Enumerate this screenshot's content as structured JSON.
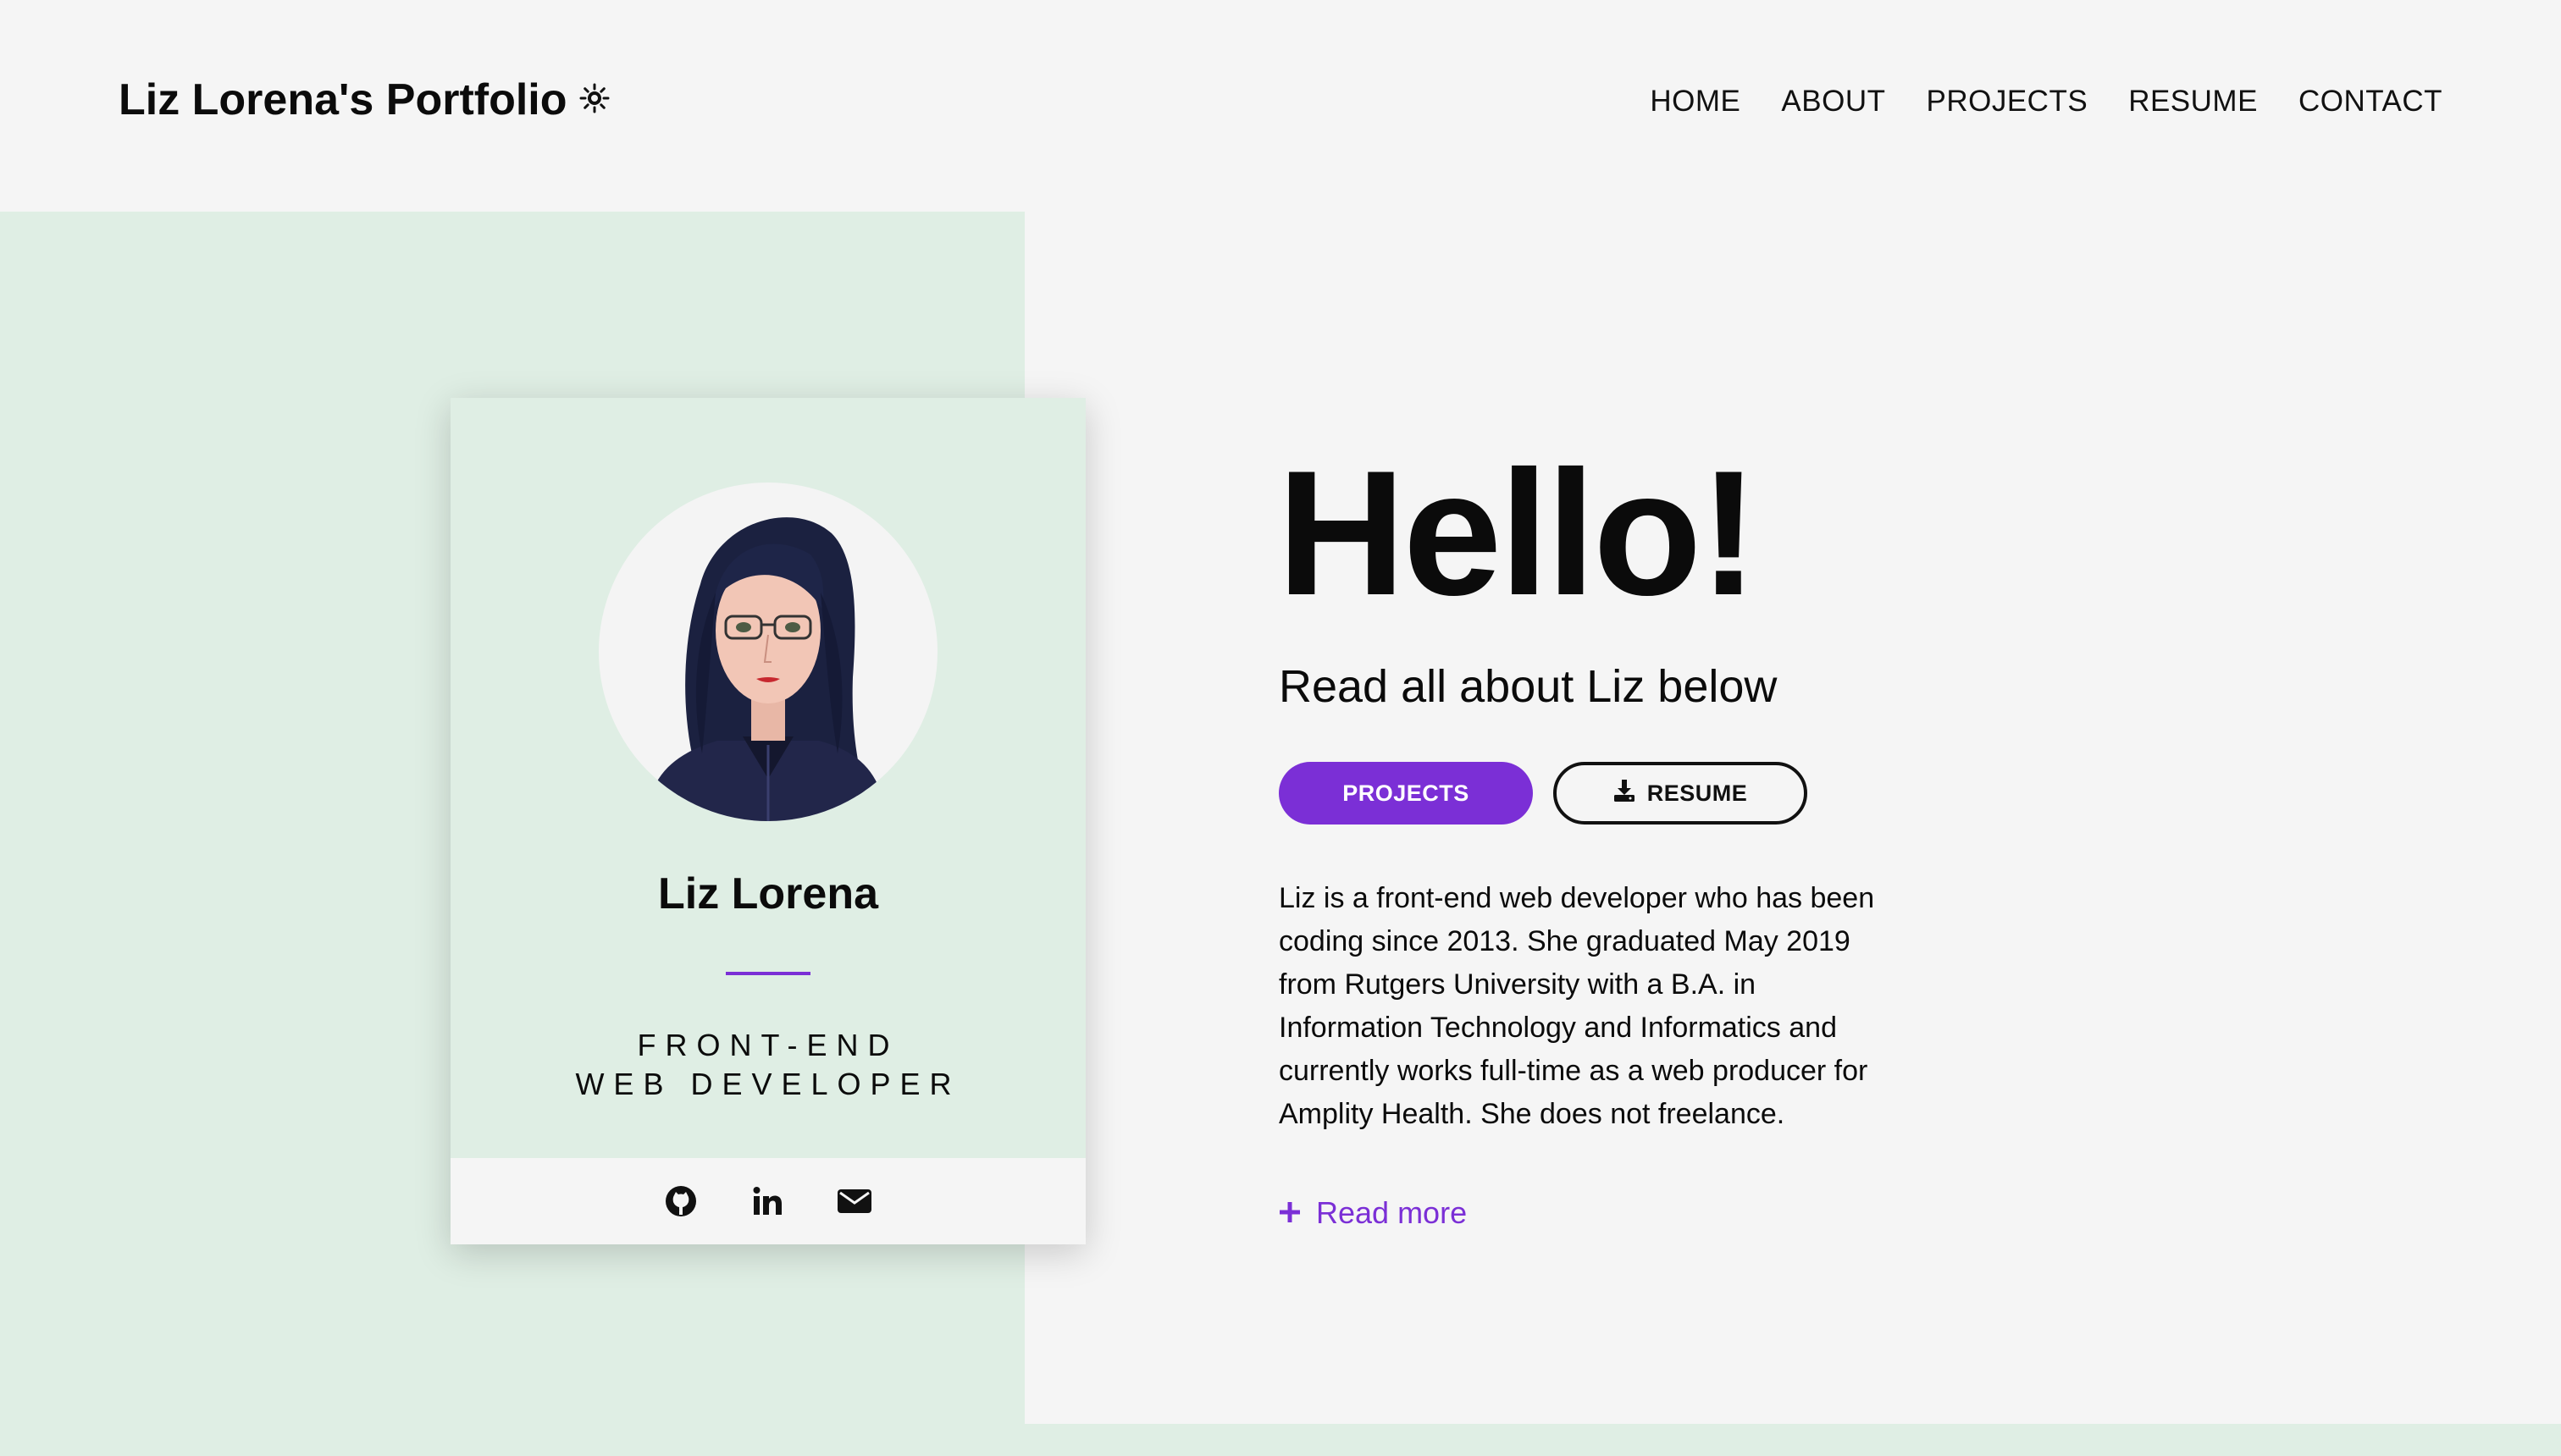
{
  "header": {
    "brand": "Liz Lorena's Portfolio",
    "brand_icon": "sun-icon",
    "nav": [
      "HOME",
      "ABOUT",
      "PROJECTS",
      "RESUME",
      "CONTACT"
    ]
  },
  "card": {
    "avatar_icon": "avatar-image",
    "name": "Liz Lorena",
    "role_line1": "FRONT-END",
    "role_line2": "WEB DEVELOPER",
    "social": [
      "github-icon",
      "linkedin-icon",
      "email-icon"
    ]
  },
  "hero": {
    "title": "Hello!",
    "subtitle": "Read all about Liz below",
    "projects_button": "PROJECTS",
    "resume_button": "RESUME",
    "bio": "Liz is a front-end web developer who has been coding since 2013. She graduated May 2019 from Rutgers University with a B.A. in Information Technology and Informatics and currently works full-time as a web producer for Amplity Health. She does not freelance.",
    "read_more": "Read more"
  },
  "colors": {
    "accent": "#7b2fd6",
    "mint": "#dfeee4",
    "background": "#f5f5f5",
    "text": "#0b0b0b"
  }
}
